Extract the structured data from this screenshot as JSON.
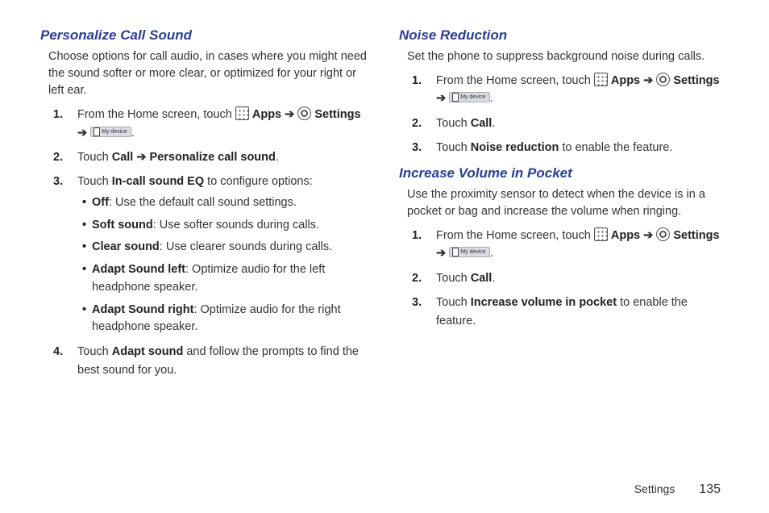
{
  "left": {
    "title": "Personalize Call Sound",
    "intro": "Choose options for call audio, in cases where you might need the sound softer or more clear, or optimized for your right or left ear.",
    "steps": {
      "s1_prefix": "From the Home screen, touch ",
      "s1_apps": "Apps",
      "s1_arrow1": " ➔ ",
      "s1_settings": "Settings",
      "s1_arrow2": " ➔ ",
      "s1_mydevice": "My device",
      "s1_period": ".",
      "s2_prefix": "Touch ",
      "s2_b1": "Call",
      "s2_arrow": " ➔ ",
      "s2_b2": "Personalize call sound",
      "s2_period": ".",
      "s3_prefix": "Touch ",
      "s3_b": "In-call sound EQ",
      "s3_suffix": " to configure options:",
      "bul1_b": "Off",
      "bul1_t": ": Use the default call sound settings.",
      "bul2_b": "Soft sound",
      "bul2_t": ": Use softer sounds during calls.",
      "bul3_b": "Clear sound",
      "bul3_t": ": Use clearer sounds during calls.",
      "bul4_b": "Adapt Sound left",
      "bul4_t": ": Optimize audio for the left headphone speaker.",
      "bul5_b": "Adapt Sound right",
      "bul5_t": ": Optimize audio for the right headphone speaker.",
      "s4_prefix": "Touch ",
      "s4_b": "Adapt sound",
      "s4_suffix": " and follow the prompts to find the best sound for you."
    }
  },
  "right": {
    "sec1": {
      "title": "Noise Reduction",
      "intro": "Set the phone to suppress background noise during calls.",
      "s1_prefix": "From the Home screen, touch ",
      "s1_apps": "Apps",
      "s1_arrow1": " ➔ ",
      "s1_settings": "Settings",
      "s1_arrow2": " ➔ ",
      "s1_mydevice": "My device",
      "s1_period": ".",
      "s2_prefix": "Touch ",
      "s2_b": "Call",
      "s2_period": ".",
      "s3_prefix": "Touch ",
      "s3_b": "Noise reduction",
      "s3_suffix": " to enable the feature."
    },
    "sec2": {
      "title": "Increase Volume in Pocket",
      "intro": "Use the proximity sensor to detect when the device is in a pocket or bag and increase the volume when ringing.",
      "s1_prefix": "From the Home screen, touch ",
      "s1_apps": "Apps",
      "s1_arrow1": " ➔ ",
      "s1_settings": "Settings",
      "s1_arrow2": " ➔ ",
      "s1_mydevice": "My device",
      "s1_period": ".",
      "s2_prefix": "Touch ",
      "s2_b": "Call",
      "s2_period": ".",
      "s3_prefix": "Touch ",
      "s3_b": "Increase volume in pocket",
      "s3_suffix": " to enable the feature."
    }
  },
  "footer": {
    "section": "Settings",
    "page": "135"
  }
}
